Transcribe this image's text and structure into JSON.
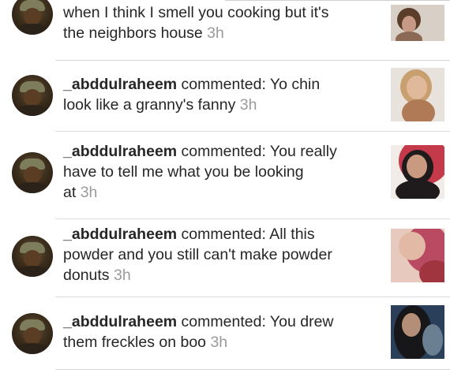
{
  "notifications": [
    {
      "text_line_1": "when I think I smell you cooking but it's",
      "text_line_2": "the neighbors house",
      "time": "3h",
      "thumb_colors": [
        "#d8cfc6",
        "#8a6a55",
        "#c79a86"
      ]
    },
    {
      "username": "_abddulraheem",
      "text_line_1_rest": " commented: Yo chin",
      "text_line_2": "look like a granny's fanny",
      "time": "3h",
      "thumb_colors": [
        "#e8e2dc",
        "#c89a72",
        "#b07a56"
      ]
    },
    {
      "username": "_abddulraheem",
      "text_line_1_rest": " commented: You really",
      "text_line_2": "have to tell me what you be looking",
      "text_line_3": "at",
      "time": "3h",
      "thumb_colors": [
        "#c43a4a",
        "#1f1a1c",
        "#c99a80"
      ]
    },
    {
      "username": "_abddulraheem",
      "text_line_1_rest": " commented: All this",
      "text_line_2": "powder and you still can't make powder",
      "text_line_3": "donuts",
      "time": "3h",
      "thumb_colors": [
        "#b94a62",
        "#e2b9a5",
        "#a0343f"
      ]
    },
    {
      "username": "_abddulraheem",
      "text_line_1_rest": " commented: You drew",
      "text_line_2": "them freckles on boo",
      "time": "3h",
      "thumb_colors": [
        "#2a3f5a",
        "#17171a",
        "#b58e78"
      ]
    }
  ]
}
